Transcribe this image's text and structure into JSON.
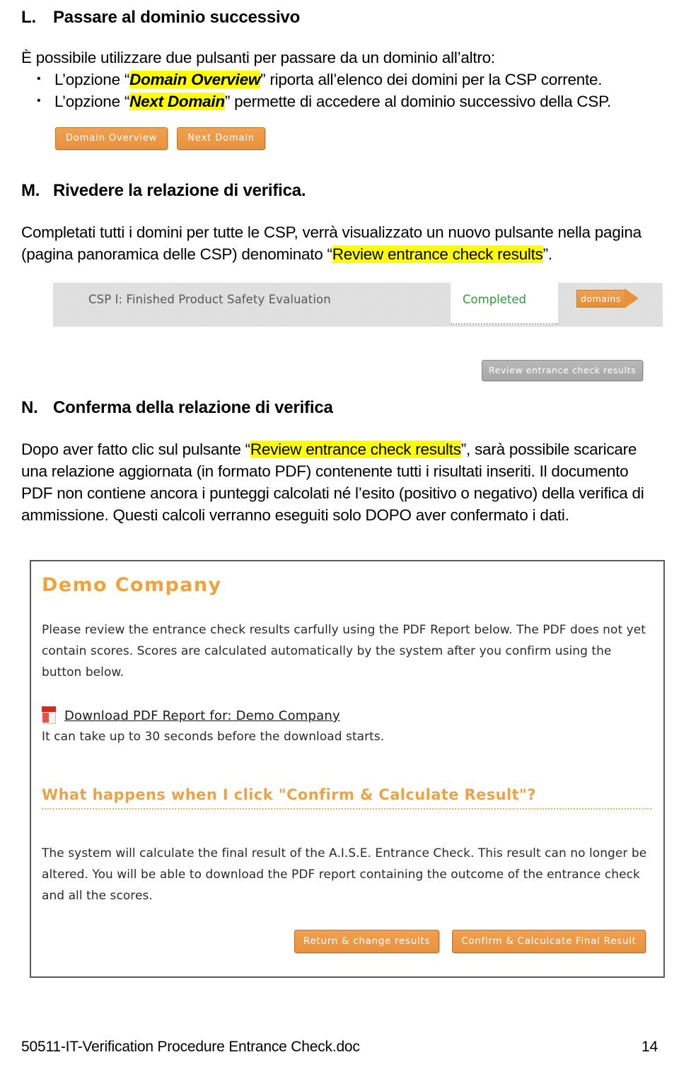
{
  "document": {
    "footer_filename": "50511-IT-Verification Procedure Entrance Check.doc",
    "footer_page": "14"
  },
  "section_l": {
    "letter": "L.",
    "title": "Passare al dominio successivo",
    "intro": "È possibile utilizzare due pulsanti per passare da un dominio all’altro:",
    "bullets": [
      {
        "before": "L’opzione “",
        "highlight": "Domain Overview",
        "after": "” riporta all’elenco dei domini per la CSP corrente."
      },
      {
        "before": "L’opzione “",
        "highlight": "Next Domain",
        "after": "” permette di accedere al dominio successivo della CSP."
      }
    ],
    "buttons": [
      "Domain Overview",
      "Next Domain"
    ]
  },
  "section_m": {
    "letter": "M.",
    "title": "Rivedere la relazione di verifica.",
    "paragraph_before": "Completati tutti i domini per tutte le CSP, verrà visualizzato un nuovo pulsante nella pagina (pagina panoramica delle CSP) denominato “",
    "paragraph_highlight": "Review entrance check results",
    "paragraph_after": "”.",
    "csp_row": {
      "title": "CSP I: Finished Product Safety Evaluation",
      "status": "Completed",
      "status_color": "#2f9b3a",
      "domains_button": "domains"
    },
    "review_button": "Review entrance check results"
  },
  "section_n": {
    "letter": "N.",
    "title": "Conferma della relazione di verifica",
    "paragraph_before": "Dopo aver fatto clic sul pulsante “",
    "paragraph_highlight": "Review entrance check results",
    "paragraph_after": "”, sarà possibile scaricare una relazione aggiornata (in formato PDF) contenente tutti i risultati inseriti. Il documento PDF non contiene ancora i punteggi calcolati né l’esito (positivo o negativo) della verifica di ammissione. Questi calcoli verranno eseguiti solo DOPO aver confermato i dati."
  },
  "demo_panel": {
    "title": "Demo Company",
    "title_color": "#f0a33c",
    "intro": "Please review the entrance check results carfully using the PDF Report below. The PDF does not yet contain scores. Scores are calculated automatically by the system after you confirm using the button below.",
    "pdf_link": "Download PDF Report for: Demo Company",
    "pdf_note": "It can take up to 30 seconds before the download starts.",
    "confirm_heading": "What happens when I click \"Confirm & Calculate Result\"?",
    "confirm_body": "The system will calculate the final result of the A.I.S.E. Entrance Check. This result can no longer be altered. You will be able to download the PDF report containing the outcome of the entrance check and all the scores.",
    "buttons": [
      "Return & change results",
      "Confirm & Calculcate Final Result"
    ]
  }
}
